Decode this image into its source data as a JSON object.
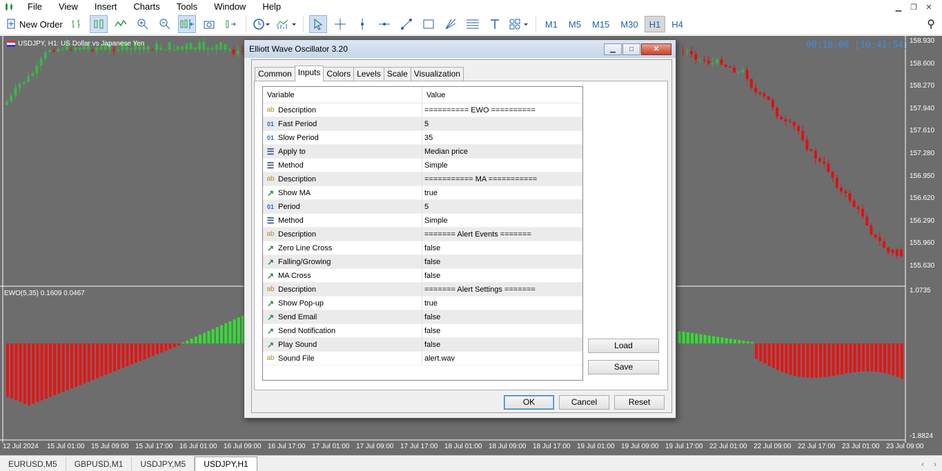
{
  "menu": [
    "File",
    "View",
    "Insert",
    "Charts",
    "Tools",
    "Window",
    "Help"
  ],
  "toolbar": {
    "new_order": "New Order",
    "timeframes": [
      "M1",
      "M5",
      "M15",
      "M30",
      "H1",
      "H4"
    ],
    "active_timeframe": "H1"
  },
  "chart": {
    "title": "USDJPY, H1:  US Dollar vs Japanese Yen",
    "timer": "00:18:06 [10:41:54]",
    "indicator_label": "EWO(5,35) 0.1609 0.0467",
    "price_labels": [
      "158.930",
      "158.600",
      "158.270",
      "157.940",
      "157.610",
      "157.280",
      "156.950",
      "156.620",
      "156.290",
      "155.960",
      "155.630"
    ],
    "indicator_levels": [
      "1.0735",
      "-1.8824"
    ],
    "time_labels": [
      "12 Jul 2024",
      "15 Jul 01:00",
      "15 Jul 09:00",
      "15 Jul 17:00",
      "16 Jul 01:00",
      "16 Jul 09:00",
      "16 Jul 17:00",
      "17 Jul 01:00",
      "17 Jul 09:00",
      "17 Jul 17:00",
      "18 Jul 01:00",
      "18 Jul 09:00",
      "18 Jul 17:00",
      "19 Jul 01:00",
      "19 Jul 09:00",
      "19 Jul 17:00",
      "22 Jul 01:00",
      "22 Jul 09:00",
      "22 Jul 17:00",
      "23 Jul 01:00",
      "23 Jul 09:00"
    ],
    "colors": {
      "background": "#6d6d6d",
      "bull": "#3cb44b",
      "bear": "#e01010",
      "hist_up": "#33dd33",
      "hist_down": "#ee1111"
    }
  },
  "dialog": {
    "title": "Elliott Wave Oscillator 3.20",
    "tabs": [
      "Common",
      "Inputs",
      "Colors",
      "Levels",
      "Scale",
      "Visualization"
    ],
    "active_tab": "Inputs",
    "columns": {
      "variable": "Variable",
      "value": "Value"
    },
    "rows": [
      {
        "icon": "ab",
        "name": "Description",
        "value": "========== EWO =========="
      },
      {
        "icon": "01",
        "name": "Fast Period",
        "value": "5"
      },
      {
        "icon": "01",
        "name": "Slow Period",
        "value": "35"
      },
      {
        "icon": "enum",
        "name": "Apply to",
        "value": "Median price"
      },
      {
        "icon": "enum",
        "name": "Method",
        "value": "Simple"
      },
      {
        "icon": "ab",
        "name": "Description",
        "value": "=========== MA ==========="
      },
      {
        "icon": "bool",
        "name": "Show MA",
        "value": "true"
      },
      {
        "icon": "01",
        "name": "Period",
        "value": "5"
      },
      {
        "icon": "enum",
        "name": "Method",
        "value": "Simple"
      },
      {
        "icon": "ab",
        "name": "Description",
        "value": "======= Alert Events ======="
      },
      {
        "icon": "bool",
        "name": "Zero Line Cross",
        "value": "false"
      },
      {
        "icon": "bool",
        "name": "Falling/Growing",
        "value": "false"
      },
      {
        "icon": "bool",
        "name": "MA Cross",
        "value": "false"
      },
      {
        "icon": "ab",
        "name": "Description",
        "value": "======= Alert Settings ======="
      },
      {
        "icon": "bool",
        "name": "Show Pop-up",
        "value": "true"
      },
      {
        "icon": "bool",
        "name": "Send Email",
        "value": "false"
      },
      {
        "icon": "bool",
        "name": "Send Notification",
        "value": "false"
      },
      {
        "icon": "bool",
        "name": "Play Sound",
        "value": "false"
      },
      {
        "icon": "ab",
        "name": "Sound File",
        "value": "alert.wav"
      }
    ],
    "load_label": "Load",
    "save_label": "Save",
    "ok_label": "OK",
    "cancel_label": "Cancel",
    "reset_label": "Reset"
  },
  "bottom_tabs": [
    "EURUSD,M5",
    "GBPUSD,M1",
    "USDJPY,M5",
    "USDJPY,H1"
  ],
  "active_bottom_tab": "USDJPY,H1"
}
